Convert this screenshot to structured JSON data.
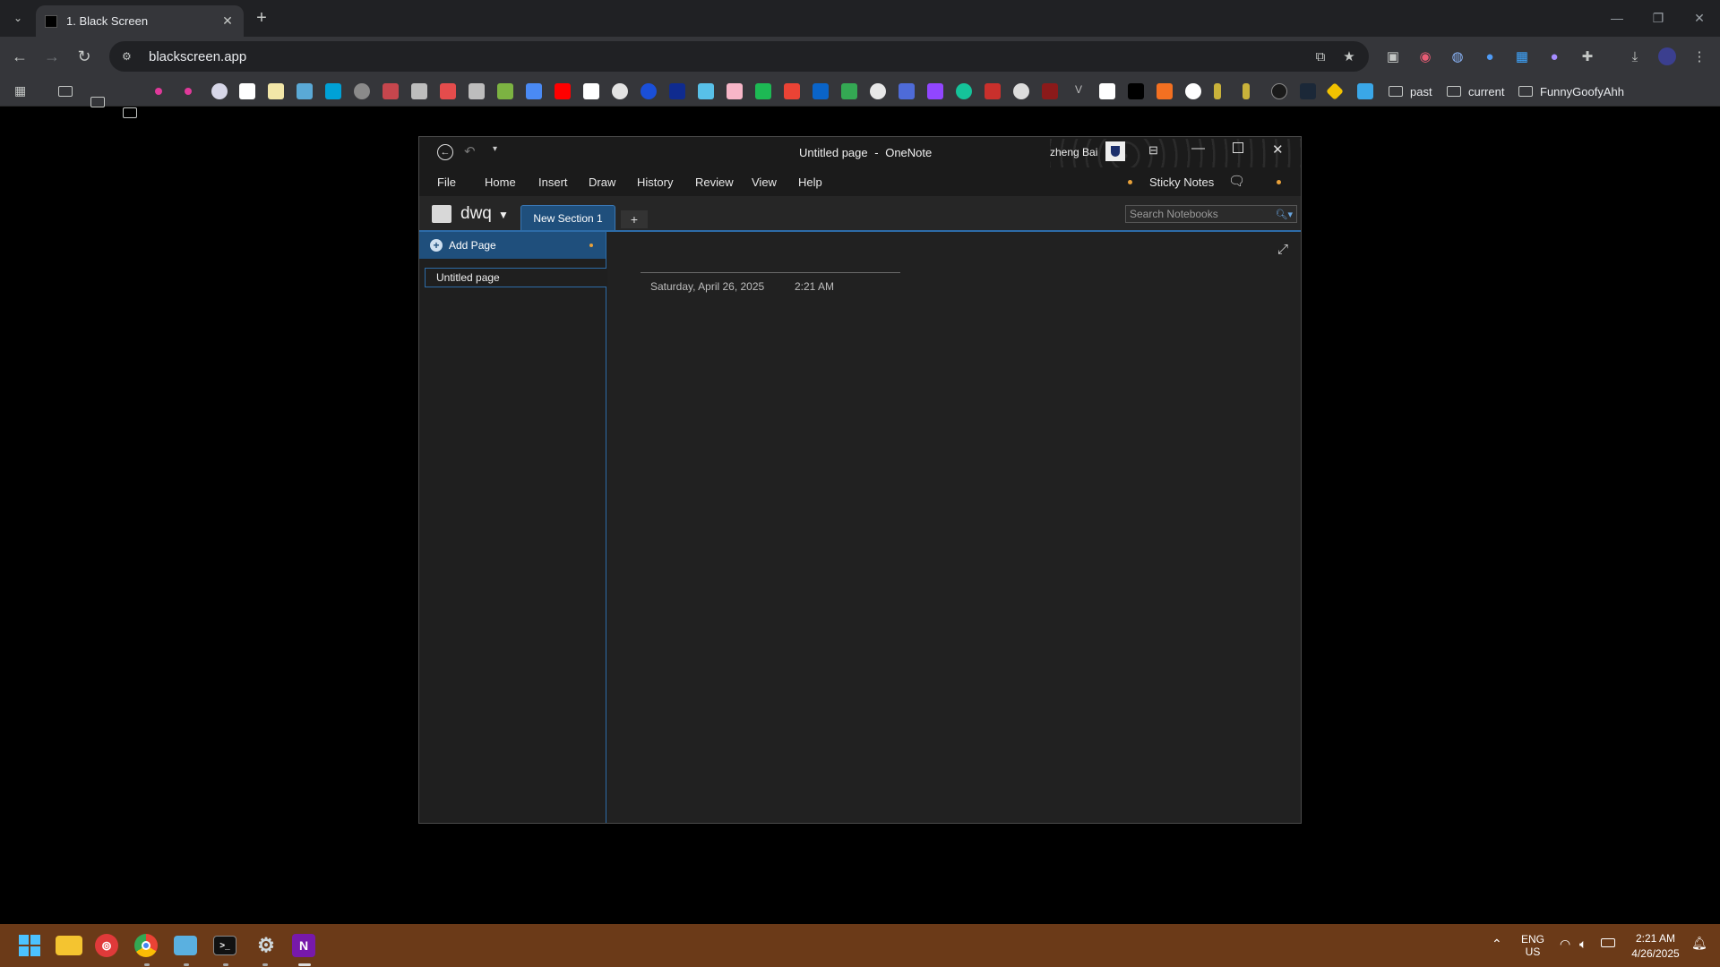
{
  "browser": {
    "tab_title": "1. Black Screen",
    "url": "blackscreen.app",
    "new_tab_label": "+",
    "bookmark_folders": [
      "past",
      "current",
      "FunnyGoofyAhh"
    ],
    "colors": {
      "frame": "#202124",
      "toolbar": "#35363a",
      "omnibox": "#202124"
    }
  },
  "onenote": {
    "window_title": "Untitled page",
    "app_name": "OneNote",
    "title_separator": "-",
    "user_name": "zheng Bai",
    "menu": [
      "File",
      "Home",
      "Insert",
      "Draw",
      "History",
      "Review",
      "View",
      "Help"
    ],
    "sticky_notes_label": "Sticky Notes",
    "notebook_name": "dwq",
    "section_tab": "New Section 1",
    "add_section_label": "+",
    "search_placeholder": "Search Notebooks",
    "add_page_label": "Add Page",
    "pages": [
      "Untitled page"
    ],
    "page_date": "Saturday, April 26, 2025",
    "page_time": "2:21 AM",
    "colors": {
      "accent": "#2d6ca8",
      "selected_tab": "#1f4f7c",
      "dot": "#e8a13a"
    }
  },
  "taskbar": {
    "language": "ENG",
    "region": "US",
    "time": "2:21 AM",
    "date": "4/26/2025",
    "onenote_icon_letter": "N",
    "color": "#6b3a18"
  }
}
